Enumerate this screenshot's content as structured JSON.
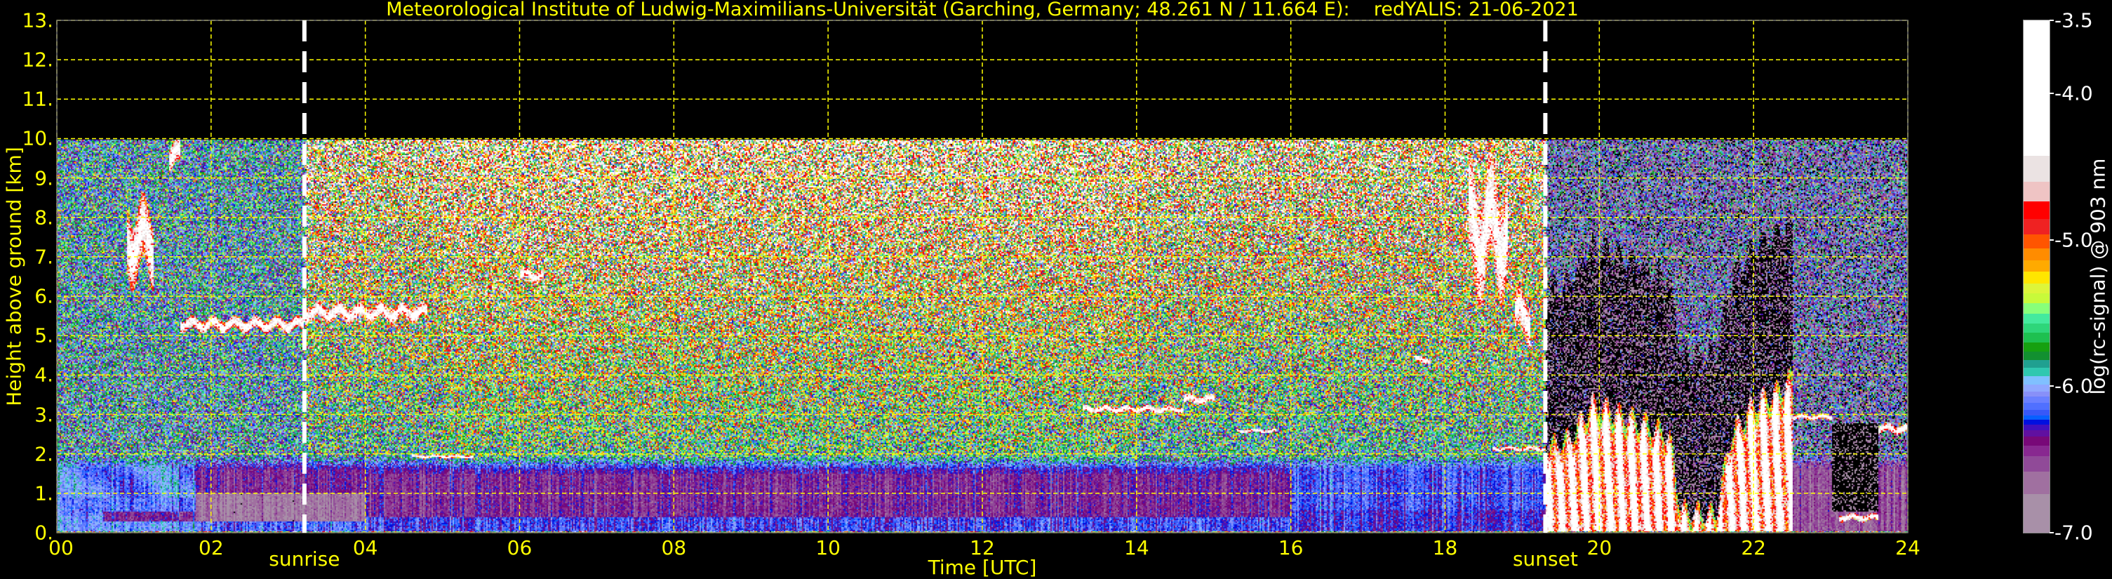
{
  "chart_data": {
    "type": "heatmap",
    "title": "Meteorological Institute of Ludwig-Maximilians-Universität (Garching, Germany; 48.261 N / 11.664 E):    redYALIS: 21-06-2021",
    "xlabel": "Time [UTC]",
    "ylabel": "Height above ground [km]",
    "xlim": [
      0,
      24
    ],
    "ylim": [
      0,
      13
    ],
    "data_top_km": 10,
    "grid": true,
    "grid_color": "#ffff00",
    "text_color": "#ffff00",
    "xticks": [
      0,
      2,
      4,
      6,
      8,
      10,
      12,
      14,
      16,
      18,
      20,
      22,
      24
    ],
    "xtick_labels": [
      "00",
      "02",
      "04",
      "06",
      "08",
      "10",
      "12",
      "14",
      "16",
      "18",
      "20",
      "22",
      "24"
    ],
    "yticks": [
      0,
      1,
      2,
      3,
      4,
      5,
      6,
      7,
      8,
      9,
      10,
      11,
      12,
      13
    ],
    "ytick_labels": [
      "0.",
      "1.",
      "2.",
      "3.",
      "4.",
      "5.",
      "6.",
      "7.",
      "8.",
      "9.",
      "10.",
      "11.",
      "12.",
      "13."
    ],
    "annotations": [
      {
        "label": "sunrise",
        "time_h": 3.21
      },
      {
        "label": "sunset",
        "time_h": 19.3
      }
    ],
    "colorbar": {
      "label": "log(rc-signal) @ 903 nm",
      "min": -7.0,
      "max": -3.5,
      "ticks": [
        -3.5,
        -4.0,
        -5.0,
        -6.0,
        -7.0
      ],
      "tick_labels": [
        "-3.5",
        "-4.0",
        "-5.0",
        "-6.0",
        "-7.0"
      ],
      "levels": [
        {
          "from": -4.425,
          "to": -3.5,
          "color": "#ffffff"
        },
        {
          "from": -4.604,
          "to": -4.425,
          "color": "#ebe3e3"
        },
        {
          "from": -4.738,
          "to": -4.604,
          "color": "#efc4c4"
        },
        {
          "from": -4.859,
          "to": -4.738,
          "color": "#ff0000"
        },
        {
          "from": -4.96,
          "to": -4.859,
          "color": "#ef2222"
        },
        {
          "from": -5.056,
          "to": -4.96,
          "color": "#ff5500"
        },
        {
          "from": -5.139,
          "to": -5.056,
          "color": "#ff8c00"
        },
        {
          "from": -5.217,
          "to": -5.139,
          "color": "#ffaa00"
        },
        {
          "from": -5.298,
          "to": -5.217,
          "color": "#ffe600"
        },
        {
          "from": -5.366,
          "to": -5.298,
          "color": "#ddf53a"
        },
        {
          "from": -5.434,
          "to": -5.366,
          "color": "#c8fa3a"
        },
        {
          "from": -5.505,
          "to": -5.434,
          "color": "#88ff7a"
        },
        {
          "from": -5.57,
          "to": -5.505,
          "color": "#44ea9e"
        },
        {
          "from": -5.633,
          "to": -5.57,
          "color": "#2ed67a"
        },
        {
          "from": -5.699,
          "to": -5.633,
          "color": "#1ec050"
        },
        {
          "from": -5.762,
          "to": -5.699,
          "color": "#16a010"
        },
        {
          "from": -5.822,
          "to": -5.762,
          "color": "#129030"
        },
        {
          "from": -5.875,
          "to": -5.822,
          "color": "#20a090"
        },
        {
          "from": -5.933,
          "to": -5.875,
          "color": "#30c8b0"
        },
        {
          "from": -5.989,
          "to": -5.933,
          "color": "#80c0ff"
        },
        {
          "from": -6.034,
          "to": -5.989,
          "color": "#90a8ff"
        },
        {
          "from": -6.072,
          "to": -6.034,
          "color": "#8890f8"
        },
        {
          "from": -6.115,
          "to": -6.072,
          "color": "#6a80ff"
        },
        {
          "from": -6.16,
          "to": -6.115,
          "color": "#5070ff"
        },
        {
          "from": -6.2,
          "to": -6.16,
          "color": "#3858f8"
        },
        {
          "from": -6.228,
          "to": -6.2,
          "color": "#0860ff"
        },
        {
          "from": -6.261,
          "to": -6.228,
          "color": "#0010e0"
        },
        {
          "from": -6.301,
          "to": -6.261,
          "color": "#4010c0"
        },
        {
          "from": -6.342,
          "to": -6.301,
          "color": "#6010a0"
        },
        {
          "from": -6.405,
          "to": -6.342,
          "color": "#780878"
        },
        {
          "from": -6.478,
          "to": -6.405,
          "color": "#882890"
        },
        {
          "from": -6.584,
          "to": -6.478,
          "color": "#904a98"
        },
        {
          "from": -6.735,
          "to": -6.584,
          "color": "#a070a0"
        },
        {
          "from": -7.0,
          "to": -6.735,
          "color": "#a890a8"
        }
      ]
    },
    "cloud_layers_km": [
      {
        "t0": 0.9,
        "t1": 1.25,
        "h": 7.4,
        "thick": 1.6
      },
      {
        "t0": 1.45,
        "t1": 1.6,
        "h": 9.6,
        "thick": 0.6
      },
      {
        "t0": 1.6,
        "t1": 3.2,
        "h": 5.3,
        "thick": 0.3
      },
      {
        "t0": 3.2,
        "t1": 4.8,
        "h": 5.6,
        "thick": 0.35
      },
      {
        "t0": 4.6,
        "t1": 5.4,
        "h": 1.95,
        "thick": 0.08
      },
      {
        "t0": 6.0,
        "t1": 6.3,
        "h": 6.55,
        "thick": 0.25
      },
      {
        "t0": 13.3,
        "t1": 14.6,
        "h": 3.15,
        "thick": 0.15
      },
      {
        "t0": 14.6,
        "t1": 15.0,
        "h": 3.4,
        "thick": 0.2
      },
      {
        "t0": 15.3,
        "t1": 15.8,
        "h": 2.6,
        "thick": 0.08
      },
      {
        "t0": 17.6,
        "t1": 17.8,
        "h": 4.4,
        "thick": 0.15
      },
      {
        "t0": 18.3,
        "t1": 18.8,
        "h": 7.7,
        "thick": 2.5
      },
      {
        "t0": 18.9,
        "t1": 19.1,
        "h": 5.5,
        "thick": 1.0
      },
      {
        "t0": 18.6,
        "t1": 19.3,
        "h": 2.15,
        "thick": 0.1
      },
      {
        "t0": 22.5,
        "t1": 23.0,
        "h": 2.95,
        "thick": 0.12
      },
      {
        "t0": 23.1,
        "t1": 23.6,
        "h": 0.4,
        "thick": 0.15
      },
      {
        "t0": 23.5,
        "t1": 24.0,
        "h": 2.65,
        "thick": 0.2
      }
    ],
    "low_cloud": {
      "t0": 19.3,
      "t1": 22.5,
      "top_km_at": [
        [
          19.3,
          2.2
        ],
        [
          19.6,
          2.4
        ],
        [
          19.9,
          3.3
        ],
        [
          20.3,
          3.0
        ],
        [
          20.6,
          2.8
        ],
        [
          20.9,
          2.5
        ],
        [
          21.05,
          0.6
        ],
        [
          21.5,
          0.5
        ],
        [
          21.7,
          2.5
        ],
        [
          22.0,
          3.3
        ],
        [
          22.3,
          3.6
        ],
        [
          22.5,
          4.0
        ]
      ]
    }
  }
}
